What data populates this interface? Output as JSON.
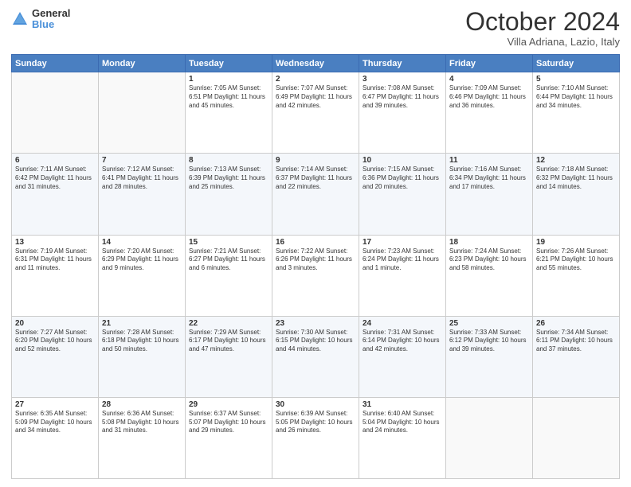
{
  "header": {
    "logo_general": "General",
    "logo_blue": "Blue",
    "month_title": "October 2024",
    "subtitle": "Villa Adriana, Lazio, Italy"
  },
  "days_of_week": [
    "Sunday",
    "Monday",
    "Tuesday",
    "Wednesday",
    "Thursday",
    "Friday",
    "Saturday"
  ],
  "weeks": [
    [
      {
        "day": "",
        "content": ""
      },
      {
        "day": "",
        "content": ""
      },
      {
        "day": "1",
        "content": "Sunrise: 7:05 AM\nSunset: 6:51 PM\nDaylight: 11 hours and 45 minutes."
      },
      {
        "day": "2",
        "content": "Sunrise: 7:07 AM\nSunset: 6:49 PM\nDaylight: 11 hours and 42 minutes."
      },
      {
        "day": "3",
        "content": "Sunrise: 7:08 AM\nSunset: 6:47 PM\nDaylight: 11 hours and 39 minutes."
      },
      {
        "day": "4",
        "content": "Sunrise: 7:09 AM\nSunset: 6:46 PM\nDaylight: 11 hours and 36 minutes."
      },
      {
        "day": "5",
        "content": "Sunrise: 7:10 AM\nSunset: 6:44 PM\nDaylight: 11 hours and 34 minutes."
      }
    ],
    [
      {
        "day": "6",
        "content": "Sunrise: 7:11 AM\nSunset: 6:42 PM\nDaylight: 11 hours and 31 minutes."
      },
      {
        "day": "7",
        "content": "Sunrise: 7:12 AM\nSunset: 6:41 PM\nDaylight: 11 hours and 28 minutes."
      },
      {
        "day": "8",
        "content": "Sunrise: 7:13 AM\nSunset: 6:39 PM\nDaylight: 11 hours and 25 minutes."
      },
      {
        "day": "9",
        "content": "Sunrise: 7:14 AM\nSunset: 6:37 PM\nDaylight: 11 hours and 22 minutes."
      },
      {
        "day": "10",
        "content": "Sunrise: 7:15 AM\nSunset: 6:36 PM\nDaylight: 11 hours and 20 minutes."
      },
      {
        "day": "11",
        "content": "Sunrise: 7:16 AM\nSunset: 6:34 PM\nDaylight: 11 hours and 17 minutes."
      },
      {
        "day": "12",
        "content": "Sunrise: 7:18 AM\nSunset: 6:32 PM\nDaylight: 11 hours and 14 minutes."
      }
    ],
    [
      {
        "day": "13",
        "content": "Sunrise: 7:19 AM\nSunset: 6:31 PM\nDaylight: 11 hours and 11 minutes."
      },
      {
        "day": "14",
        "content": "Sunrise: 7:20 AM\nSunset: 6:29 PM\nDaylight: 11 hours and 9 minutes."
      },
      {
        "day": "15",
        "content": "Sunrise: 7:21 AM\nSunset: 6:27 PM\nDaylight: 11 hours and 6 minutes."
      },
      {
        "day": "16",
        "content": "Sunrise: 7:22 AM\nSunset: 6:26 PM\nDaylight: 11 hours and 3 minutes."
      },
      {
        "day": "17",
        "content": "Sunrise: 7:23 AM\nSunset: 6:24 PM\nDaylight: 11 hours and 1 minute."
      },
      {
        "day": "18",
        "content": "Sunrise: 7:24 AM\nSunset: 6:23 PM\nDaylight: 10 hours and 58 minutes."
      },
      {
        "day": "19",
        "content": "Sunrise: 7:26 AM\nSunset: 6:21 PM\nDaylight: 10 hours and 55 minutes."
      }
    ],
    [
      {
        "day": "20",
        "content": "Sunrise: 7:27 AM\nSunset: 6:20 PM\nDaylight: 10 hours and 52 minutes."
      },
      {
        "day": "21",
        "content": "Sunrise: 7:28 AM\nSunset: 6:18 PM\nDaylight: 10 hours and 50 minutes."
      },
      {
        "day": "22",
        "content": "Sunrise: 7:29 AM\nSunset: 6:17 PM\nDaylight: 10 hours and 47 minutes."
      },
      {
        "day": "23",
        "content": "Sunrise: 7:30 AM\nSunset: 6:15 PM\nDaylight: 10 hours and 44 minutes."
      },
      {
        "day": "24",
        "content": "Sunrise: 7:31 AM\nSunset: 6:14 PM\nDaylight: 10 hours and 42 minutes."
      },
      {
        "day": "25",
        "content": "Sunrise: 7:33 AM\nSunset: 6:12 PM\nDaylight: 10 hours and 39 minutes."
      },
      {
        "day": "26",
        "content": "Sunrise: 7:34 AM\nSunset: 6:11 PM\nDaylight: 10 hours and 37 minutes."
      }
    ],
    [
      {
        "day": "27",
        "content": "Sunrise: 6:35 AM\nSunset: 5:09 PM\nDaylight: 10 hours and 34 minutes."
      },
      {
        "day": "28",
        "content": "Sunrise: 6:36 AM\nSunset: 5:08 PM\nDaylight: 10 hours and 31 minutes."
      },
      {
        "day": "29",
        "content": "Sunrise: 6:37 AM\nSunset: 5:07 PM\nDaylight: 10 hours and 29 minutes."
      },
      {
        "day": "30",
        "content": "Sunrise: 6:39 AM\nSunset: 5:05 PM\nDaylight: 10 hours and 26 minutes."
      },
      {
        "day": "31",
        "content": "Sunrise: 6:40 AM\nSunset: 5:04 PM\nDaylight: 10 hours and 24 minutes."
      },
      {
        "day": "",
        "content": ""
      },
      {
        "day": "",
        "content": ""
      }
    ]
  ]
}
